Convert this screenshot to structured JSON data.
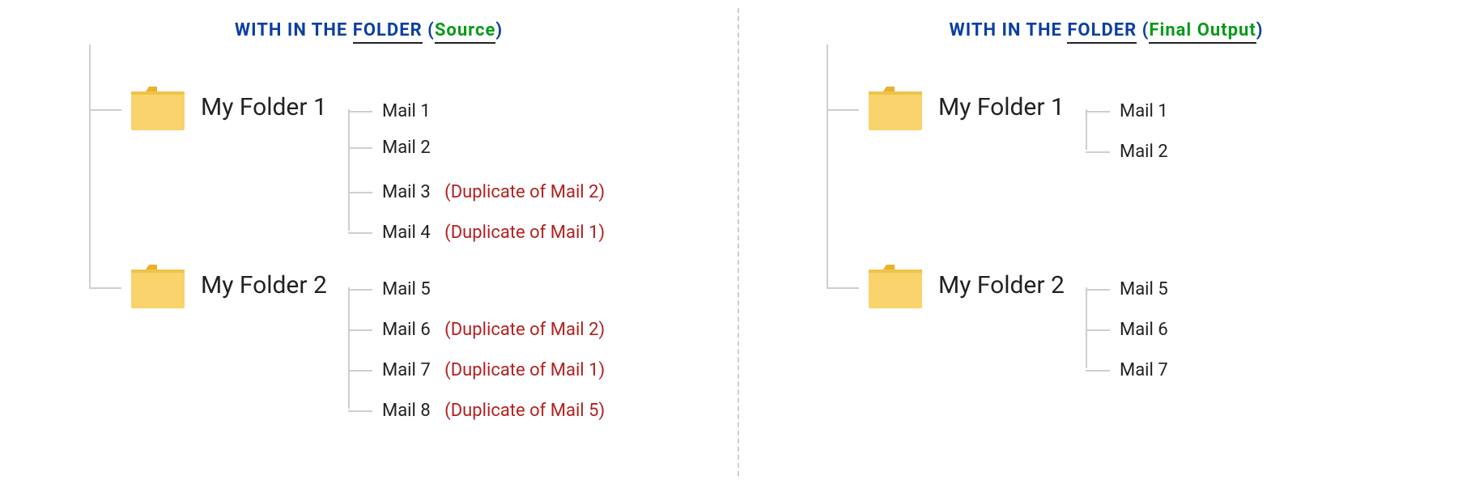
{
  "title_parts": {
    "with_in_the": "WITH IN THE",
    "folder": "FOLDER",
    "paren_open": "(",
    "paren_close": ")"
  },
  "panels": [
    {
      "side": "left",
      "title_accent": "Source",
      "folders": [
        {
          "label": "My Folder 1",
          "mails": [
            {
              "name": "Mail 1",
              "dup": ""
            },
            {
              "name": "Mail 2",
              "dup": ""
            },
            {
              "name": "Mail 3",
              "dup": "(Duplicate of Mail 2)"
            },
            {
              "name": "Mail 4",
              "dup": "(Duplicate of Mail 1)"
            }
          ]
        },
        {
          "label": "My Folder 2",
          "mails": [
            {
              "name": "Mail 5",
              "dup": ""
            },
            {
              "name": "Mail 6",
              "dup": "(Duplicate of Mail 2)"
            },
            {
              "name": "Mail 7",
              "dup": "(Duplicate of Mail 1)"
            },
            {
              "name": "Mail 8",
              "dup": "(Duplicate of Mail 5)"
            }
          ]
        }
      ]
    },
    {
      "side": "right",
      "title_accent": "Final Output",
      "folders": [
        {
          "label": "My Folder 1",
          "mails": [
            {
              "name": "Mail 1",
              "dup": ""
            },
            {
              "name": "Mail 2",
              "dup": ""
            }
          ]
        },
        {
          "label": "My Folder 2",
          "mails": [
            {
              "name": "Mail 5",
              "dup": ""
            },
            {
              "name": "Mail 6",
              "dup": ""
            },
            {
              "name": "Mail 7",
              "dup": ""
            }
          ]
        }
      ]
    }
  ]
}
